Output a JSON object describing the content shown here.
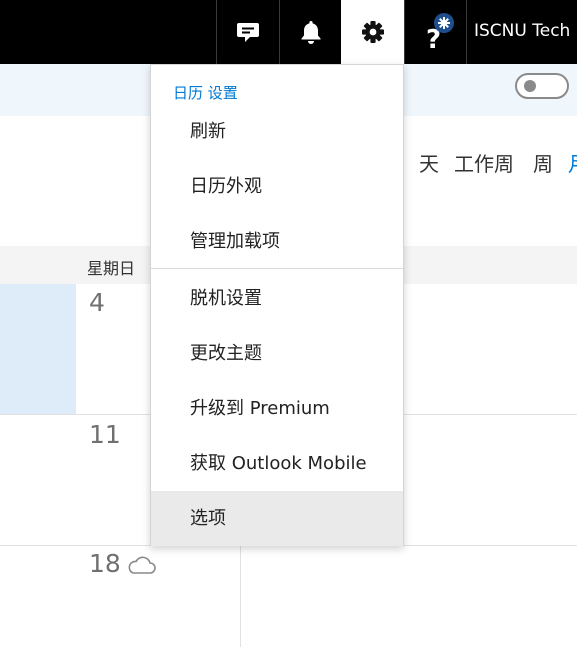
{
  "topbar": {
    "icons": {
      "chat": "chat-bubble-icon",
      "notifications": "bell-icon",
      "settings": "gear-icon",
      "help": "help-question-icon"
    },
    "user_name": "ISCNU Tech",
    "colors": {
      "background": "#000000",
      "active": "#ffffff"
    }
  },
  "view_switcher": {
    "tabs": [
      {
        "label": "天"
      },
      {
        "label": "工作周"
      },
      {
        "label": "周"
      },
      {
        "label": "月"
      }
    ],
    "accent": "#0078d4"
  },
  "calendar": {
    "day_header": "星期日",
    "dates": [
      "4",
      "11",
      "18"
    ],
    "weather_icon": "cloud-icon",
    "highlight_color": "#deecf9"
  },
  "settings_menu": {
    "header": "日历 设置",
    "items": [
      {
        "label": "刷新"
      },
      {
        "label": "日历外观"
      },
      {
        "label": "管理加载项"
      },
      {
        "label": "脱机设置"
      },
      {
        "label": "更改主题"
      },
      {
        "label": "升级到 Premium"
      },
      {
        "label": "获取 Outlook Mobile"
      },
      {
        "label": "选项"
      }
    ]
  }
}
